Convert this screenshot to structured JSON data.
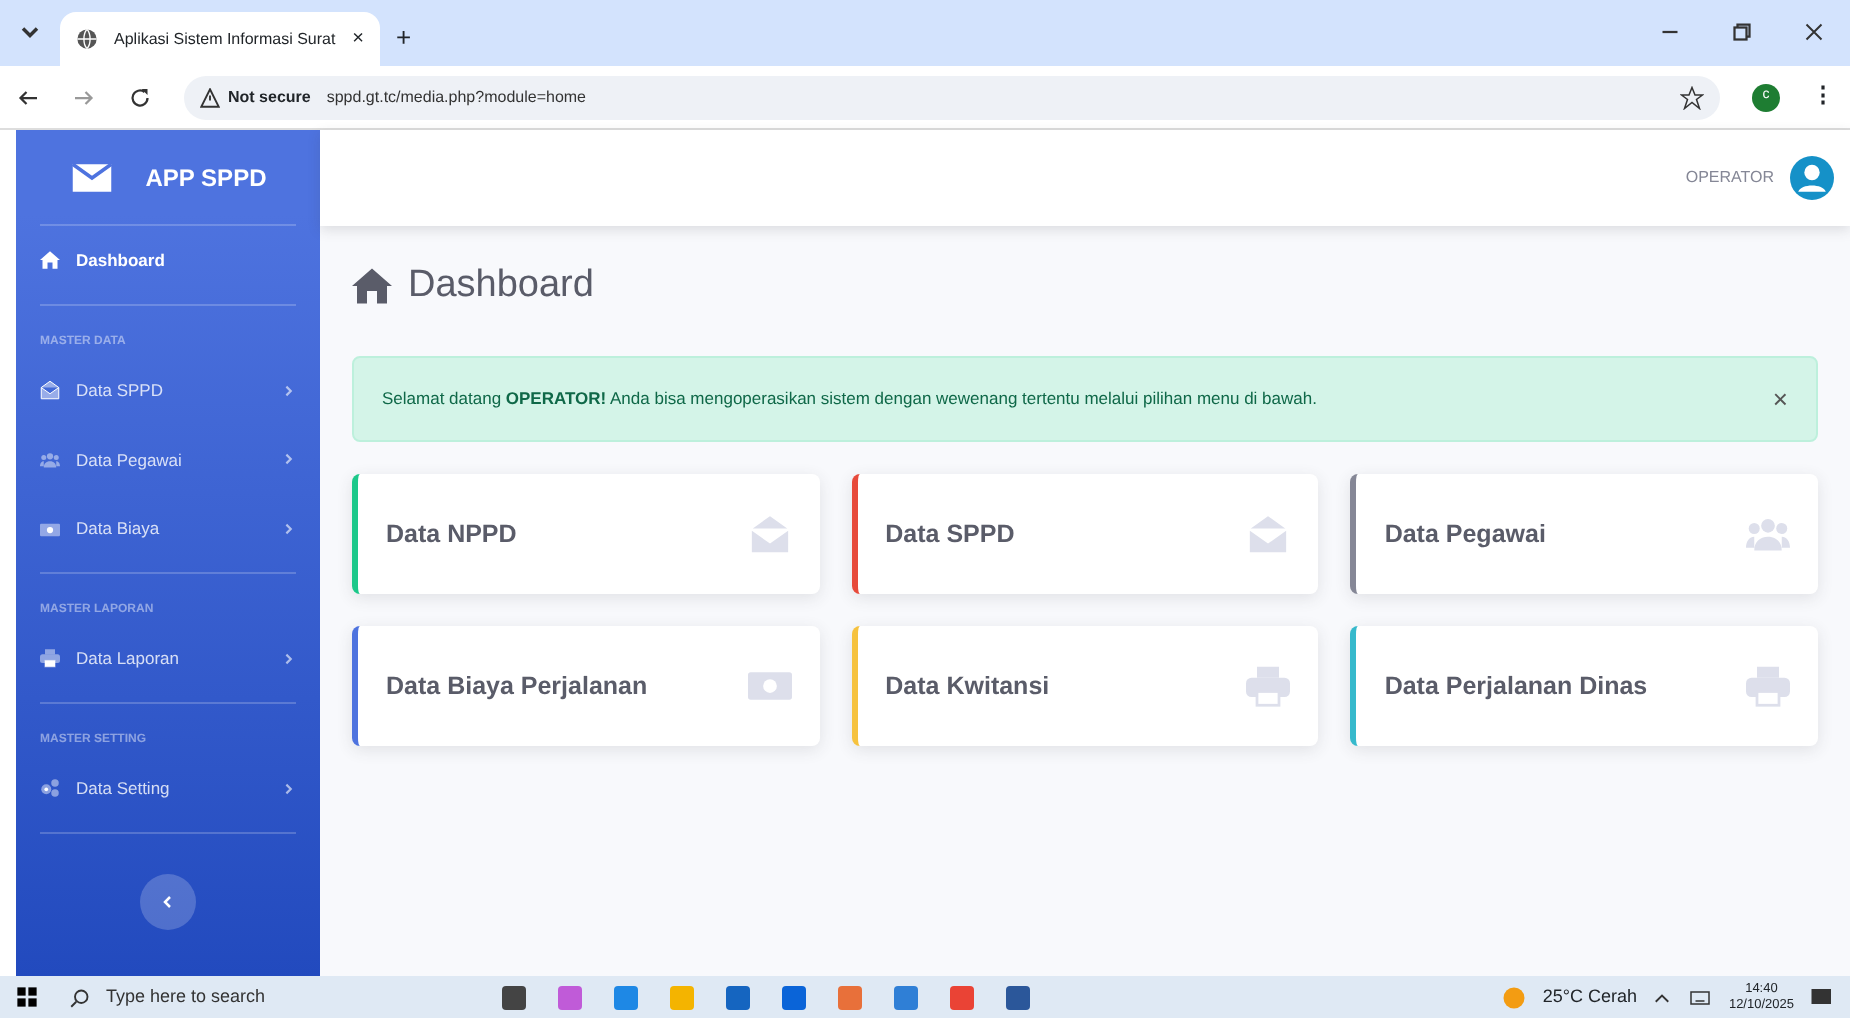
{
  "browser": {
    "tab_title": "Aplikasi Sistem Informasi Surat",
    "tab_close": "×",
    "new_tab": "+",
    "not_secure": "Not secure",
    "url": "sppd.gt.tc/media.php?module=home",
    "profile": "c",
    "menu": "⋮"
  },
  "sidebar": {
    "brand": "APP SPPD",
    "items": [
      {
        "kind": "link",
        "label": "Dashboard",
        "selected": true
      },
      {
        "kind": "heading",
        "label": "MASTER DATA"
      },
      {
        "kind": "dropdown",
        "label": "Data SPPD",
        "selected": false
      },
      {
        "kind": "dropdown",
        "label": "Data Pegawai",
        "selected": false
      },
      {
        "kind": "dropdown",
        "label": "Data Biaya",
        "selected": false
      },
      {
        "kind": "heading",
        "label": "MASTER LAPORAN"
      },
      {
        "kind": "dropdown",
        "label": "Data Laporan",
        "selected": false
      },
      {
        "kind": "heading",
        "label": "MASTER SETTING"
      },
      {
        "kind": "dropdown",
        "label": "Data Setting",
        "selected": false
      }
    ]
  },
  "topbar": {
    "user": "OPERATOR"
  },
  "page_title": "Dashboard",
  "alert": {
    "text": "Selamat datang **OPERATOR!** Anda bisa mengoperasikan sistem dengan wewenang tertentu melalui pilihan menu di bawah.",
    "close": "×"
  },
  "cards": [
    {
      "label": "Data NPPD",
      "color": "#1cc88a"
    },
    {
      "label": "Data SPPD",
      "color": "#e74a3b"
    },
    {
      "label": "Data Pegawai",
      "color": "#858796"
    },
    {
      "label": "Data Biaya Perjalanan",
      "color": "#4e73df"
    },
    {
      "label": "Data Kwitansi",
      "color": "#f6c23e"
    },
    {
      "label": "Data Perjalanan Dinas",
      "color": "#36b9cc"
    }
  ],
  "taskbar": {
    "search_placeholder": "Type here to search",
    "weather": "25°C Cerah",
    "time": "14:40",
    "date": "12/10/2025"
  }
}
